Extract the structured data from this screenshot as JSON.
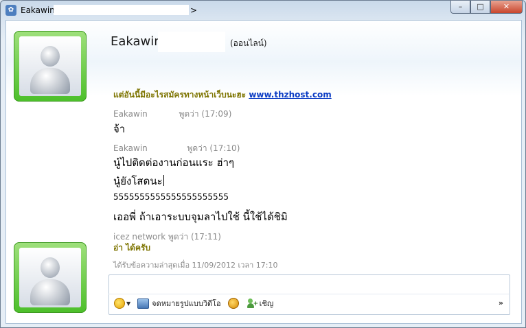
{
  "window": {
    "title": "Eakawin",
    "title_arrow": ">",
    "controls": {
      "minimize": "–",
      "maximize": "□",
      "close": "✕"
    }
  },
  "contact": {
    "name": "Eakawin",
    "status": "(ออนไลน์)"
  },
  "messages": [
    {
      "type": "olive",
      "text": "แต่อันนี้มีอะไรสมัครทางหน้าเว็บนะฮะ ",
      "link": "www.thzhost.com"
    },
    {
      "type": "sender",
      "name": "Eakawin",
      "says": "พูดว่า (17:09)"
    },
    {
      "type": "big",
      "text": "จ้า"
    },
    {
      "type": "sender",
      "name": "Eakawin",
      "says": "พูดว่า (17:10)"
    },
    {
      "type": "big",
      "text": "นู๋ไปติดต่องานก่อนแระ ฮ่าๆ"
    },
    {
      "type": "big",
      "text": "นู๋ยังโสดนะ"
    },
    {
      "type": "small",
      "text": "5555555555555555555555"
    },
    {
      "type": "big",
      "text": "เออพี่ ถ้าเอาระบบจุมลาไปใช้ นี้ใช้ได้ชิมิ"
    },
    {
      "type": "sender",
      "name": "icez network",
      "says": "พูดว่า (17:11)"
    },
    {
      "type": "olive",
      "text": "อ่า ได้ครับ"
    }
  ],
  "last_received": "ได้รับข้อความล่าสุดเมื่อ 11/09/2012 เวลา 17:10",
  "toolbar": {
    "video_label": "จดหมายรูปแบบวิดีโอ",
    "invite_label": "เชิญ",
    "more": "»"
  },
  "icons": [
    "messenger-icon",
    "emoticon-icon",
    "video-message-icon",
    "nudge-icon",
    "invite-icon",
    "person-icon"
  ]
}
